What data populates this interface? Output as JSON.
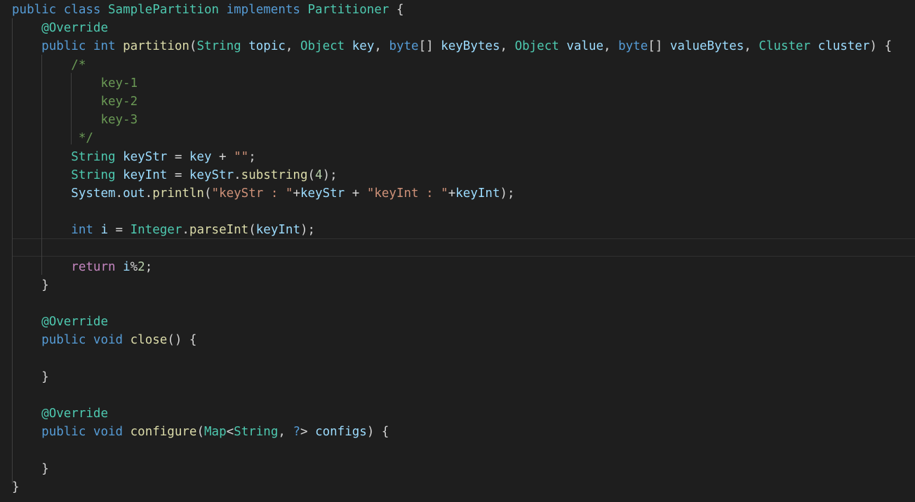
{
  "editor": {
    "colors": {
      "background": "#1e1e1e",
      "keyword": "#569cd6",
      "control": "#c586c0",
      "type": "#4ec9b0",
      "variable": "#9cdcfe",
      "function": "#dcdcaa",
      "string": "#ce9178",
      "number": "#b5cea8",
      "comment": "#6a9955",
      "text": "#d4d4d4"
    },
    "lines": [
      {
        "tokens": [
          {
            "t": "public",
            "c": "kw"
          },
          {
            "t": " ",
            "c": "pun"
          },
          {
            "t": "class",
            "c": "kw"
          },
          {
            "t": " ",
            "c": "pun"
          },
          {
            "t": "SamplePartition",
            "c": "type"
          },
          {
            "t": " ",
            "c": "pun"
          },
          {
            "t": "implements",
            "c": "kw"
          },
          {
            "t": " ",
            "c": "pun"
          },
          {
            "t": "Partitioner",
            "c": "type"
          },
          {
            "t": " {",
            "c": "pun"
          }
        ]
      },
      {
        "tokens": [
          {
            "t": "    ",
            "c": "pun"
          },
          {
            "t": "@Override",
            "c": "ann"
          }
        ]
      },
      {
        "tokens": [
          {
            "t": "    ",
            "c": "pun"
          },
          {
            "t": "public",
            "c": "kw"
          },
          {
            "t": " ",
            "c": "pun"
          },
          {
            "t": "int",
            "c": "kw"
          },
          {
            "t": " ",
            "c": "pun"
          },
          {
            "t": "partition",
            "c": "fn"
          },
          {
            "t": "(",
            "c": "pun"
          },
          {
            "t": "String",
            "c": "type"
          },
          {
            "t": " ",
            "c": "pun"
          },
          {
            "t": "topic",
            "c": "var"
          },
          {
            "t": ", ",
            "c": "pun"
          },
          {
            "t": "Object",
            "c": "type"
          },
          {
            "t": " ",
            "c": "pun"
          },
          {
            "t": "key",
            "c": "var"
          },
          {
            "t": ", ",
            "c": "pun"
          },
          {
            "t": "byte",
            "c": "kw"
          },
          {
            "t": "[] ",
            "c": "pun"
          },
          {
            "t": "keyBytes",
            "c": "var"
          },
          {
            "t": ", ",
            "c": "pun"
          },
          {
            "t": "Object",
            "c": "type"
          },
          {
            "t": " ",
            "c": "pun"
          },
          {
            "t": "value",
            "c": "var"
          },
          {
            "t": ", ",
            "c": "pun"
          },
          {
            "t": "byte",
            "c": "kw"
          },
          {
            "t": "[] ",
            "c": "pun"
          },
          {
            "t": "valueBytes",
            "c": "var"
          },
          {
            "t": ", ",
            "c": "pun"
          },
          {
            "t": "Cluster",
            "c": "type"
          },
          {
            "t": " ",
            "c": "pun"
          },
          {
            "t": "cluster",
            "c": "var"
          },
          {
            "t": ") {",
            "c": "pun"
          }
        ]
      },
      {
        "tokens": [
          {
            "t": "        ",
            "c": "pun"
          },
          {
            "t": "/*",
            "c": "cmt"
          }
        ]
      },
      {
        "tokens": [
          {
            "t": "            ",
            "c": "pun"
          },
          {
            "t": "key-1",
            "c": "cmt"
          }
        ]
      },
      {
        "tokens": [
          {
            "t": "            ",
            "c": "pun"
          },
          {
            "t": "key-2",
            "c": "cmt"
          }
        ]
      },
      {
        "tokens": [
          {
            "t": "            ",
            "c": "pun"
          },
          {
            "t": "key-3",
            "c": "cmt"
          }
        ]
      },
      {
        "tokens": [
          {
            "t": "         ",
            "c": "pun"
          },
          {
            "t": "*/",
            "c": "cmt"
          }
        ]
      },
      {
        "tokens": [
          {
            "t": "        ",
            "c": "pun"
          },
          {
            "t": "String",
            "c": "type"
          },
          {
            "t": " ",
            "c": "pun"
          },
          {
            "t": "keyStr",
            "c": "var"
          },
          {
            "t": " = ",
            "c": "pun"
          },
          {
            "t": "key",
            "c": "var"
          },
          {
            "t": " + ",
            "c": "pun"
          },
          {
            "t": "\"\"",
            "c": "str"
          },
          {
            "t": ";",
            "c": "pun"
          }
        ]
      },
      {
        "tokens": [
          {
            "t": "        ",
            "c": "pun"
          },
          {
            "t": "String",
            "c": "type"
          },
          {
            "t": " ",
            "c": "pun"
          },
          {
            "t": "keyInt",
            "c": "var"
          },
          {
            "t": " = ",
            "c": "pun"
          },
          {
            "t": "keyStr",
            "c": "var"
          },
          {
            "t": ".",
            "c": "pun"
          },
          {
            "t": "substring",
            "c": "fn"
          },
          {
            "t": "(",
            "c": "pun"
          },
          {
            "t": "4",
            "c": "num"
          },
          {
            "t": ");",
            "c": "pun"
          }
        ]
      },
      {
        "tokens": [
          {
            "t": "        ",
            "c": "pun"
          },
          {
            "t": "System",
            "c": "var"
          },
          {
            "t": ".",
            "c": "pun"
          },
          {
            "t": "out",
            "c": "var"
          },
          {
            "t": ".",
            "c": "pun"
          },
          {
            "t": "println",
            "c": "fn"
          },
          {
            "t": "(",
            "c": "pun"
          },
          {
            "t": "\"keyStr : \"",
            "c": "str"
          },
          {
            "t": "+",
            "c": "pun"
          },
          {
            "t": "keyStr",
            "c": "var"
          },
          {
            "t": " + ",
            "c": "pun"
          },
          {
            "t": "\"keyInt : \"",
            "c": "str"
          },
          {
            "t": "+",
            "c": "pun"
          },
          {
            "t": "keyInt",
            "c": "var"
          },
          {
            "t": ");",
            "c": "pun"
          }
        ]
      },
      {
        "tokens": []
      },
      {
        "tokens": [
          {
            "t": "        ",
            "c": "pun"
          },
          {
            "t": "int",
            "c": "kw"
          },
          {
            "t": " ",
            "c": "pun"
          },
          {
            "t": "i",
            "c": "var"
          },
          {
            "t": " = ",
            "c": "pun"
          },
          {
            "t": "Integer",
            "c": "type"
          },
          {
            "t": ".",
            "c": "pun"
          },
          {
            "t": "parseInt",
            "c": "fn"
          },
          {
            "t": "(",
            "c": "pun"
          },
          {
            "t": "keyInt",
            "c": "var"
          },
          {
            "t": ");",
            "c": "pun"
          }
        ]
      },
      {
        "tokens": []
      },
      {
        "tokens": [
          {
            "t": "        ",
            "c": "pun"
          },
          {
            "t": "return",
            "c": "ctl"
          },
          {
            "t": " ",
            "c": "pun"
          },
          {
            "t": "i",
            "c": "var"
          },
          {
            "t": "%",
            "c": "pun"
          },
          {
            "t": "2",
            "c": "num"
          },
          {
            "t": ";",
            "c": "pun"
          }
        ]
      },
      {
        "tokens": [
          {
            "t": "    }",
            "c": "pun"
          }
        ]
      },
      {
        "tokens": []
      },
      {
        "tokens": [
          {
            "t": "    ",
            "c": "pun"
          },
          {
            "t": "@Override",
            "c": "ann"
          }
        ]
      },
      {
        "tokens": [
          {
            "t": "    ",
            "c": "pun"
          },
          {
            "t": "public",
            "c": "kw"
          },
          {
            "t": " ",
            "c": "pun"
          },
          {
            "t": "void",
            "c": "kw"
          },
          {
            "t": " ",
            "c": "pun"
          },
          {
            "t": "close",
            "c": "fn"
          },
          {
            "t": "() {",
            "c": "pun"
          }
        ]
      },
      {
        "tokens": []
      },
      {
        "tokens": [
          {
            "t": "    }",
            "c": "pun"
          }
        ]
      },
      {
        "tokens": []
      },
      {
        "tokens": [
          {
            "t": "    ",
            "c": "pun"
          },
          {
            "t": "@Override",
            "c": "ann"
          }
        ]
      },
      {
        "tokens": [
          {
            "t": "    ",
            "c": "pun"
          },
          {
            "t": "public",
            "c": "kw"
          },
          {
            "t": " ",
            "c": "pun"
          },
          {
            "t": "void",
            "c": "kw"
          },
          {
            "t": " ",
            "c": "pun"
          },
          {
            "t": "configure",
            "c": "fn"
          },
          {
            "t": "(",
            "c": "pun"
          },
          {
            "t": "Map",
            "c": "type"
          },
          {
            "t": "<",
            "c": "pun"
          },
          {
            "t": "String",
            "c": "type"
          },
          {
            "t": ", ",
            "c": "pun"
          },
          {
            "t": "?",
            "c": "kw"
          },
          {
            "t": "> ",
            "c": "pun"
          },
          {
            "t": "configs",
            "c": "var"
          },
          {
            "t": ") {",
            "c": "pun"
          }
        ]
      },
      {
        "tokens": []
      },
      {
        "tokens": [
          {
            "t": "    }",
            "c": "pun"
          }
        ]
      },
      {
        "tokens": [
          {
            "t": "}",
            "c": "pun"
          }
        ]
      }
    ]
  }
}
